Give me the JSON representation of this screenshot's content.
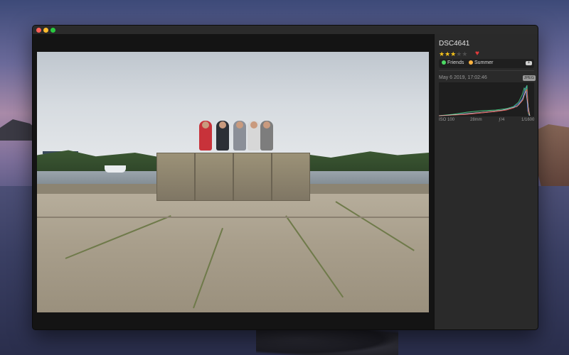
{
  "photo": {
    "name": "DSC4641",
    "rating": 3,
    "rating_max": 5,
    "favorite": true,
    "tags": [
      {
        "label": "Friends",
        "color": "#4cd964"
      },
      {
        "label": "Summer",
        "color": "#ffb340"
      }
    ],
    "date": "May 6 2019, 17:02:46",
    "format": "JPEG",
    "exif": {
      "iso": "ISO 100",
      "focal": "28mm",
      "aperture": "ƒ/4",
      "shutter": "1/1600"
    }
  },
  "icons": {
    "star": "star-icon",
    "heart": "heart-icon",
    "add_tag": "add-tag-icon"
  },
  "colors": {
    "star": "#f5c21b",
    "heart": "#e23b3b"
  }
}
